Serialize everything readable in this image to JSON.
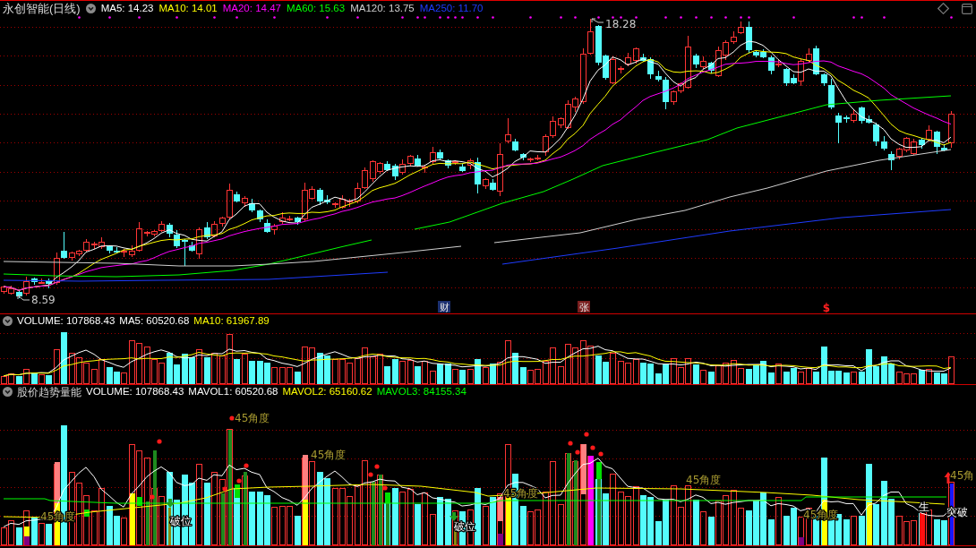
{
  "chart_title": "永创智能(日线)",
  "price_panel": {
    "indicators": [
      {
        "label": "MA5: 14.23",
        "color": "#ffffff"
      },
      {
        "label": "MA10: 14.01",
        "color": "#ffff00"
      },
      {
        "label": "MA20: 14.47",
        "color": "#ff00ff"
      },
      {
        "label": "MA60: 15.63",
        "color": "#00ff00"
      },
      {
        "label": "MA120: 13.75",
        "color": "#d0d0d0"
      },
      {
        "label": "MA250: 11.70",
        "color": "#1f3cff"
      }
    ],
    "high_label": "18.28",
    "low_label": "8.59",
    "event_markers": [
      {
        "kind": "badge",
        "text": "财",
        "color": "#1c3070"
      },
      {
        "kind": "badge",
        "text": "张",
        "color": "#7a1e1e"
      },
      {
        "kind": "symbol",
        "text": "$",
        "color": "#ff2020"
      }
    ]
  },
  "volume_panel": {
    "indicators": [
      {
        "label": "VOLUME: 107868.43",
        "color": "#ffffff"
      },
      {
        "label": "MA5: 60520.68",
        "color": "#ffffff"
      },
      {
        "label": "MA10: 61967.89",
        "color": "#ffff00"
      }
    ]
  },
  "trend_panel": {
    "title": "股价趋势量能",
    "indicators": [
      {
        "label": "VOLUME: 107868.43",
        "color": "#ffffff"
      },
      {
        "label": "MAVOL1: 60520.68",
        "color": "#ffffff"
      },
      {
        "label": "MAVOL2: 65160.62",
        "color": "#ffff00"
      },
      {
        "label": "MAVOL3: 84155.34",
        "color": "#00ff00"
      }
    ],
    "annotations": [
      {
        "kind": "angle",
        "text": "45角度"
      },
      {
        "kind": "angle",
        "text": "45角度"
      },
      {
        "kind": "angle",
        "text": "45角度"
      },
      {
        "kind": "angle",
        "text": "45角"
      },
      {
        "kind": "angle",
        "text": "45角度"
      },
      {
        "kind": "angle",
        "text": "45角度"
      },
      {
        "kind": "signal",
        "text": "破位"
      },
      {
        "kind": "signal",
        "text": "破位"
      },
      {
        "kind": "angle",
        "text": "45角度"
      },
      {
        "kind": "signal",
        "text": "生"
      },
      {
        "kind": "signal",
        "text": "突破"
      }
    ]
  }
}
